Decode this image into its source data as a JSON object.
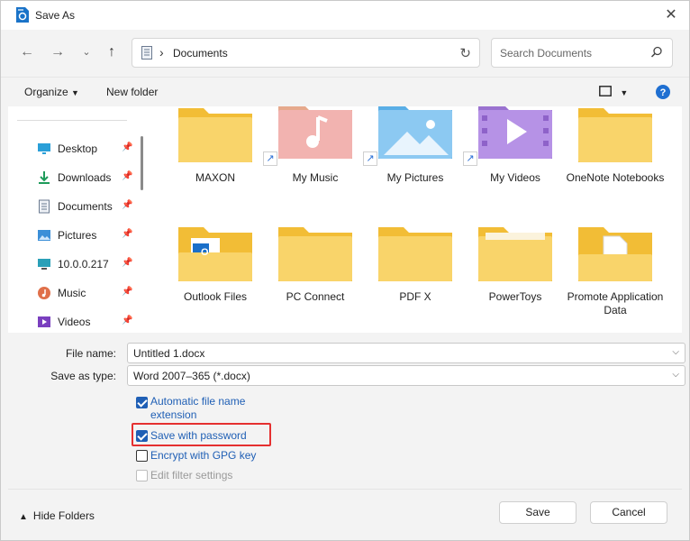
{
  "window": {
    "title": "Save As"
  },
  "nav": {
    "address": "Documents",
    "search_placeholder": "Search Documents"
  },
  "toolbar": {
    "organize_label": "Organize",
    "new_folder_label": "New folder"
  },
  "sidebar": {
    "items": [
      {
        "label": "Desktop",
        "icon": "desktop-icon"
      },
      {
        "label": "Downloads",
        "icon": "download-icon"
      },
      {
        "label": "Documents",
        "icon": "documents-icon"
      },
      {
        "label": "Pictures",
        "icon": "pictures-icon"
      },
      {
        "label": "10.0.0.217",
        "icon": "monitor-icon"
      },
      {
        "label": "Music",
        "icon": "music-icon"
      },
      {
        "label": "Videos",
        "icon": "videos-icon"
      }
    ]
  },
  "files": [
    {
      "label": "MAXON",
      "type": "folder"
    },
    {
      "label": "My Music",
      "type": "music-shortcut"
    },
    {
      "label": "My Pictures",
      "type": "pictures-shortcut"
    },
    {
      "label": "My Videos",
      "type": "videos-shortcut"
    },
    {
      "label": "OneNote Notebooks",
      "type": "folder"
    },
    {
      "label": "Outlook Files",
      "type": "outlook-folder"
    },
    {
      "label": "PC Connect",
      "type": "folder"
    },
    {
      "label": "PDF X",
      "type": "folder"
    },
    {
      "label": "PowerToys",
      "type": "folder"
    },
    {
      "label": "Promote Application Data",
      "type": "document-folder"
    }
  ],
  "form": {
    "file_name_label": "File name:",
    "file_name_value": "Untitled 1.docx",
    "save_type_label": "Save as type:",
    "save_type_value": "Word 2007–365 (*.docx)",
    "options": [
      {
        "label": "Automatic file name extension",
        "checked": true,
        "enabled": true
      },
      {
        "label": "Save with password",
        "checked": true,
        "enabled": true
      },
      {
        "label": "Encrypt with GPG key",
        "checked": false,
        "enabled": true
      },
      {
        "label": "Edit filter settings",
        "checked": false,
        "enabled": false
      }
    ]
  },
  "footer": {
    "hide_folders_label": "Hide Folders",
    "save_label": "Save",
    "cancel_label": "Cancel"
  },
  "colors": {
    "accent": "#1f5fb5",
    "highlight": "#e53030",
    "folder": "#f7cf5a"
  }
}
